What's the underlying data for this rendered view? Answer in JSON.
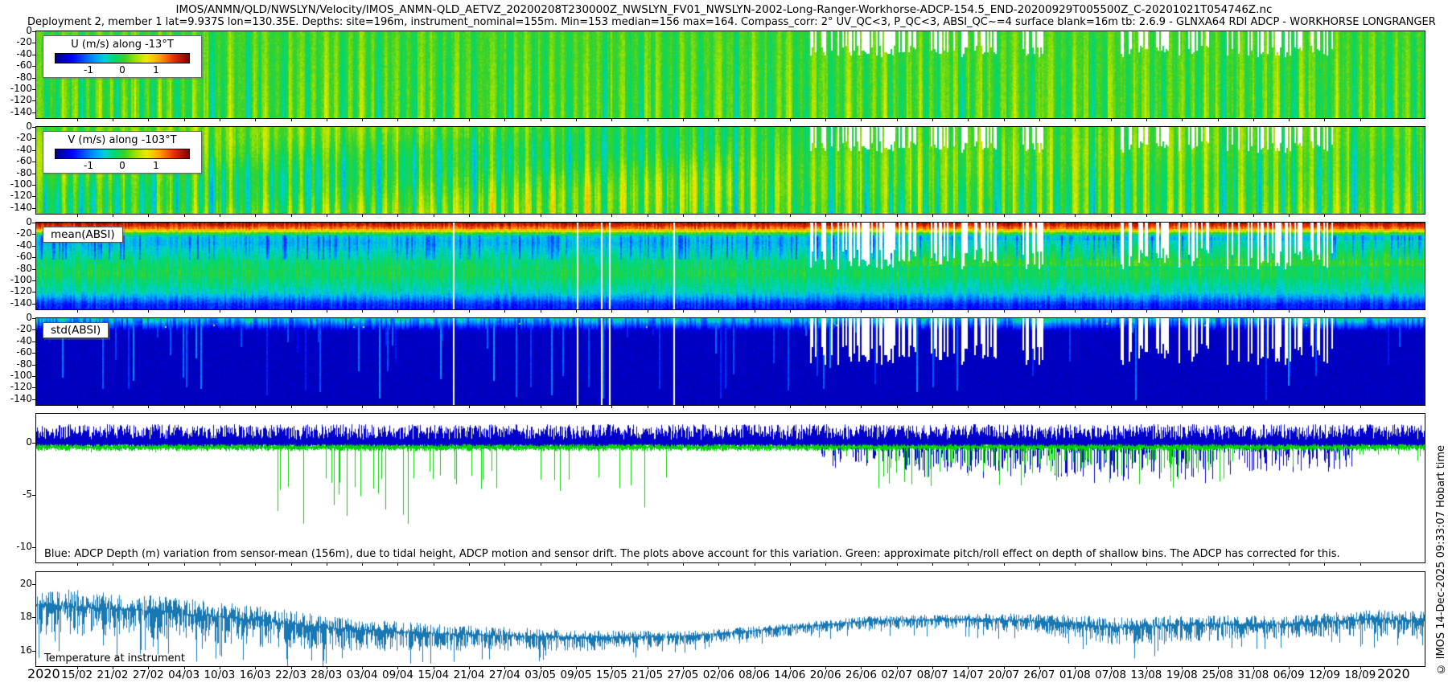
{
  "title": "IMOS/ANMN/QLD/NWSLYN/Velocity/IMOS_ANMN-QLD_AETVZ_20200208T230000Z_NWSLYN_FV01_NWSLYN-2002-Long-Ranger-Workhorse-ADCP-154.5_END-20200929T005500Z_C-20201021T054746Z.nc",
  "subtitle": "Deployment 2, member 1 lat=9.937S lon=130.35E. Depths: site=196m, instrument_nominal=155m. Min=153 median=156 max=164. Compass_corr: 2° UV_QC<3, P_QC<3, ABSI_QC~=4 surface blank=16m tb: 2.6.9 - GLNXA64 RDI ADCP - WORKHORSE LONGRANGER",
  "copyright": "© IMOS 14-Dec-2025 09:33:07 Hobart time",
  "x_axis": {
    "year_start": "2020",
    "year_end": "2020",
    "tick_labels": [
      "15/02",
      "21/02",
      "27/02",
      "04/03",
      "10/03",
      "16/03",
      "22/03",
      "28/03",
      "03/04",
      "09/04",
      "15/04",
      "21/04",
      "27/04",
      "03/05",
      "09/05",
      "15/05",
      "21/05",
      "27/05",
      "02/06",
      "08/06",
      "14/06",
      "20/06",
      "26/06",
      "02/07",
      "08/07",
      "14/07",
      "20/07",
      "26/07",
      "01/08",
      "07/08",
      "13/08",
      "19/08",
      "25/08",
      "31/08",
      "06/09",
      "12/09",
      "18/09"
    ],
    "first_tick_day": 7,
    "tick_interval_days": 6,
    "total_days": 234
  },
  "colormap": {
    "name": "jet",
    "stops": [
      [
        0.0,
        [
          0,
          0,
          130
        ]
      ],
      [
        0.125,
        [
          0,
          0,
          255
        ]
      ],
      [
        0.3,
        [
          0,
          160,
          255
        ]
      ],
      [
        0.375,
        [
          0,
          210,
          210
        ]
      ],
      [
        0.44,
        [
          0,
          215,
          110
        ]
      ],
      [
        0.52,
        [
          60,
          210,
          40
        ]
      ],
      [
        0.6,
        [
          160,
          225,
          0
        ]
      ],
      [
        0.68,
        [
          235,
          235,
          0
        ]
      ],
      [
        0.78,
        [
          255,
          160,
          0
        ]
      ],
      [
        0.88,
        [
          235,
          50,
          0
        ]
      ],
      [
        1.0,
        [
          128,
          0,
          0
        ]
      ]
    ]
  },
  "qc_gaps": {
    "comb_regions": [
      [
        0.553,
        0.725,
        0.5
      ],
      [
        0.78,
        0.935,
        0.45
      ]
    ],
    "dropout_region": [
      0.3,
      0.55,
      0.02
    ]
  },
  "chart_data": [
    {
      "type": "heatmap",
      "name": "u_velocity",
      "legend_label": "U (m/s) along -13°T",
      "colorbar_ticks": [
        "-1",
        "0",
        "1"
      ],
      "value_range_ms": [
        -2,
        2
      ],
      "typical_value_ms": 0.0,
      "value_spread_ms": [
        -0.3,
        0.4
      ],
      "y_ticks": [
        0,
        -20,
        -40,
        -60,
        -80,
        -100,
        -120,
        -140
      ],
      "depth_range_m": [
        0,
        -150
      ],
      "gen": {
        "center": 0.52,
        "col_amp": 1.0
      }
    },
    {
      "type": "heatmap",
      "name": "v_velocity",
      "legend_label": "V (m/s) along -103°T",
      "colorbar_ticks": [
        "-1",
        "0",
        "1"
      ],
      "value_range_ms": [
        -2,
        2
      ],
      "typical_value_ms": 0.0,
      "value_spread_ms": [
        -0.4,
        0.5
      ],
      "y_ticks": [
        0,
        -20,
        -40,
        -60,
        -80,
        -100,
        -120,
        -140
      ],
      "depth_range_m": [
        0,
        -150
      ],
      "gen": {
        "center": 0.52,
        "col_amp": 1.35
      }
    },
    {
      "type": "heatmap",
      "name": "mean_absi",
      "label": "mean(ABSI)",
      "y_ticks": [
        0,
        -20,
        -40,
        -60,
        -80,
        -100,
        -120,
        -140
      ],
      "depth_range_m": [
        0,
        -150
      ],
      "depth_profile": [
        [
          0.0,
          0.95
        ],
        [
          0.05,
          0.84
        ],
        [
          0.085,
          0.7
        ],
        [
          0.115,
          0.5
        ],
        [
          0.15,
          0.36
        ],
        [
          0.22,
          0.33
        ],
        [
          0.42,
          0.43
        ],
        [
          0.58,
          0.47
        ],
        [
          0.8,
          0.38
        ],
        [
          0.93,
          0.17
        ],
        [
          1.0,
          0.14
        ]
      ]
    },
    {
      "type": "heatmap",
      "name": "std_absi",
      "label": "std(ABSI)",
      "y_ticks": [
        0,
        -20,
        -40,
        -60,
        -80,
        -100,
        -120,
        -140
      ],
      "depth_range_m": [
        0,
        -150
      ],
      "depth_profile": [
        [
          0.0,
          0.34
        ],
        [
          0.045,
          0.26
        ],
        [
          0.12,
          0.1
        ],
        [
          0.16,
          0.066
        ],
        [
          1.0,
          0.06
        ]
      ]
    },
    {
      "type": "line",
      "name": "depth_variation",
      "y_ticks": [
        0,
        -5,
        -10
      ],
      "y_range_m": [
        2.8,
        -11.5
      ],
      "note": "Blue: ADCP Depth (m) variation from sensor-mean (156m), due to tidal height, ADCP motion and sensor drift. The plots above account for this variation. Green: approximate pitch/roll effect on depth of shallow bins. The ADCP has corrected for this.",
      "series": [
        {
          "name": "adcp_depth_variation",
          "color": "#0000cc",
          "band_range_m": [
            -0.6,
            2.0
          ],
          "dip_regions": [
            [
              0.565,
              0.62,
              0.5,
              2.0
            ],
            [
              0.62,
              0.75,
              0.55,
              2.8
            ],
            [
              0.75,
              0.86,
              0.55,
              3.3
            ],
            [
              0.86,
              0.95,
              0.5,
              2.6
            ]
          ]
        },
        {
          "name": "pitch_roll_effect",
          "color": "#00d400",
          "band_range_m": [
            -0.8,
            -0.1
          ],
          "spike_regions": [
            [
              0.0,
              0.17,
              0.008,
              2.5
            ],
            [
              0.17,
              0.27,
              0.07,
              9.5
            ],
            [
              0.27,
              0.35,
              0.1,
              7.0
            ],
            [
              0.35,
              0.44,
              0.05,
              9.0
            ],
            [
              0.44,
              0.55,
              0.006,
              6.0
            ],
            [
              0.55,
              0.6,
              0.03,
              3.0
            ],
            [
              0.6,
              0.72,
              0.22,
              4.8
            ],
            [
              0.72,
              0.86,
              0.25,
              4.5
            ],
            [
              0.86,
              1.0,
              0.07,
              3.2
            ]
          ]
        }
      ]
    },
    {
      "type": "line",
      "name": "temperature",
      "label": "Temperature at instrument",
      "color": "#1878b4",
      "y_ticks": [
        20,
        18,
        16
      ],
      "y_range_degC": [
        20.7,
        15.1
      ],
      "envelope": [
        [
          0.0,
          18.8,
          1.8
        ],
        [
          0.08,
          18.4,
          1.7
        ],
        [
          0.15,
          17.9,
          1.6
        ],
        [
          0.22,
          17.3,
          1.3
        ],
        [
          0.3,
          17.0,
          1.0
        ],
        [
          0.4,
          16.8,
          0.8
        ],
        [
          0.47,
          16.9,
          0.55
        ],
        [
          0.53,
          17.3,
          0.5
        ],
        [
          0.6,
          17.8,
          0.5
        ],
        [
          0.67,
          17.9,
          0.6
        ],
        [
          0.72,
          17.8,
          0.8
        ],
        [
          0.78,
          17.4,
          1.1
        ],
        [
          0.84,
          17.6,
          1.1
        ],
        [
          0.9,
          17.6,
          0.9
        ],
        [
          0.96,
          17.9,
          1.0
        ],
        [
          1.0,
          17.8,
          1.2
        ]
      ]
    }
  ]
}
